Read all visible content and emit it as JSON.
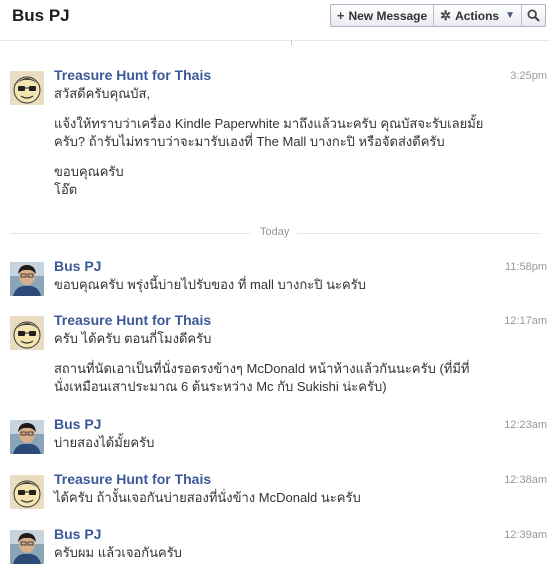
{
  "conversation": {
    "title": "Bus PJ"
  },
  "toolbar": {
    "new_message": "New Message",
    "actions": "Actions"
  },
  "divider": {
    "label": "Today"
  },
  "messages": [
    {
      "sender": "Treasure Hunt for Thais",
      "time": "3:25pm",
      "avatar": "mascot-avatar",
      "paragraphs": [
        [
          "สวัสดีครับคุณบัส,"
        ],
        [
          "แจ้งให้ทราบว่าเครื่อง Kindle Paperwhite มาถึงแล้วนะครับ คุณบัสจะรับเลยมั้ย",
          "ครับ? ถ้ารับไม่ทราบว่าจะมารับเองที่ The Mall บางกะปิ หรือจัดส่งดีครับ"
        ],
        [
          "ขอบคุณครับ",
          "โอ๊ต"
        ]
      ]
    },
    {
      "sender": "Bus PJ",
      "time": "11:58pm",
      "avatar": "person-avatar",
      "paragraphs": [
        [
          "ขอบคุณครับ พรุ่งนี้บ่ายไปรับของ ที่ mall บางกะปิ นะครับ"
        ]
      ]
    },
    {
      "sender": "Treasure Hunt for Thais",
      "time": "12:17am",
      "avatar": "mascot-avatar",
      "paragraphs": [
        [
          "ครับ ได้ครับ ตอนกี่โมงดีครับ"
        ],
        [
          "สถานที่นัดเอาเป็นที่นั่งรอตรงข้างๆ McDonald หน้าห้างแล้วกันนะครับ (ที่มีที่",
          "นั่งเหมือนเสาประมาณ 6 ต้นระหว่าง Mc กับ Sukishi น่ะครับ)"
        ]
      ]
    },
    {
      "sender": "Bus PJ",
      "time": "12:23am",
      "avatar": "person-avatar",
      "paragraphs": [
        [
          "บ่ายสองได้มั้ยครับ"
        ]
      ]
    },
    {
      "sender": "Treasure Hunt for Thais",
      "time": "12:38am",
      "avatar": "mascot-avatar",
      "paragraphs": [
        [
          "ได้ครับ ถ้างั้นเจอกันบ่ายสองที่นั่งข้าง McDonald นะครับ"
        ]
      ]
    },
    {
      "sender": "Bus PJ",
      "time": "12:39am",
      "avatar": "person-avatar",
      "paragraphs": [
        [
          "ครับผม แล้วเจอกันครับ"
        ]
      ]
    }
  ]
}
